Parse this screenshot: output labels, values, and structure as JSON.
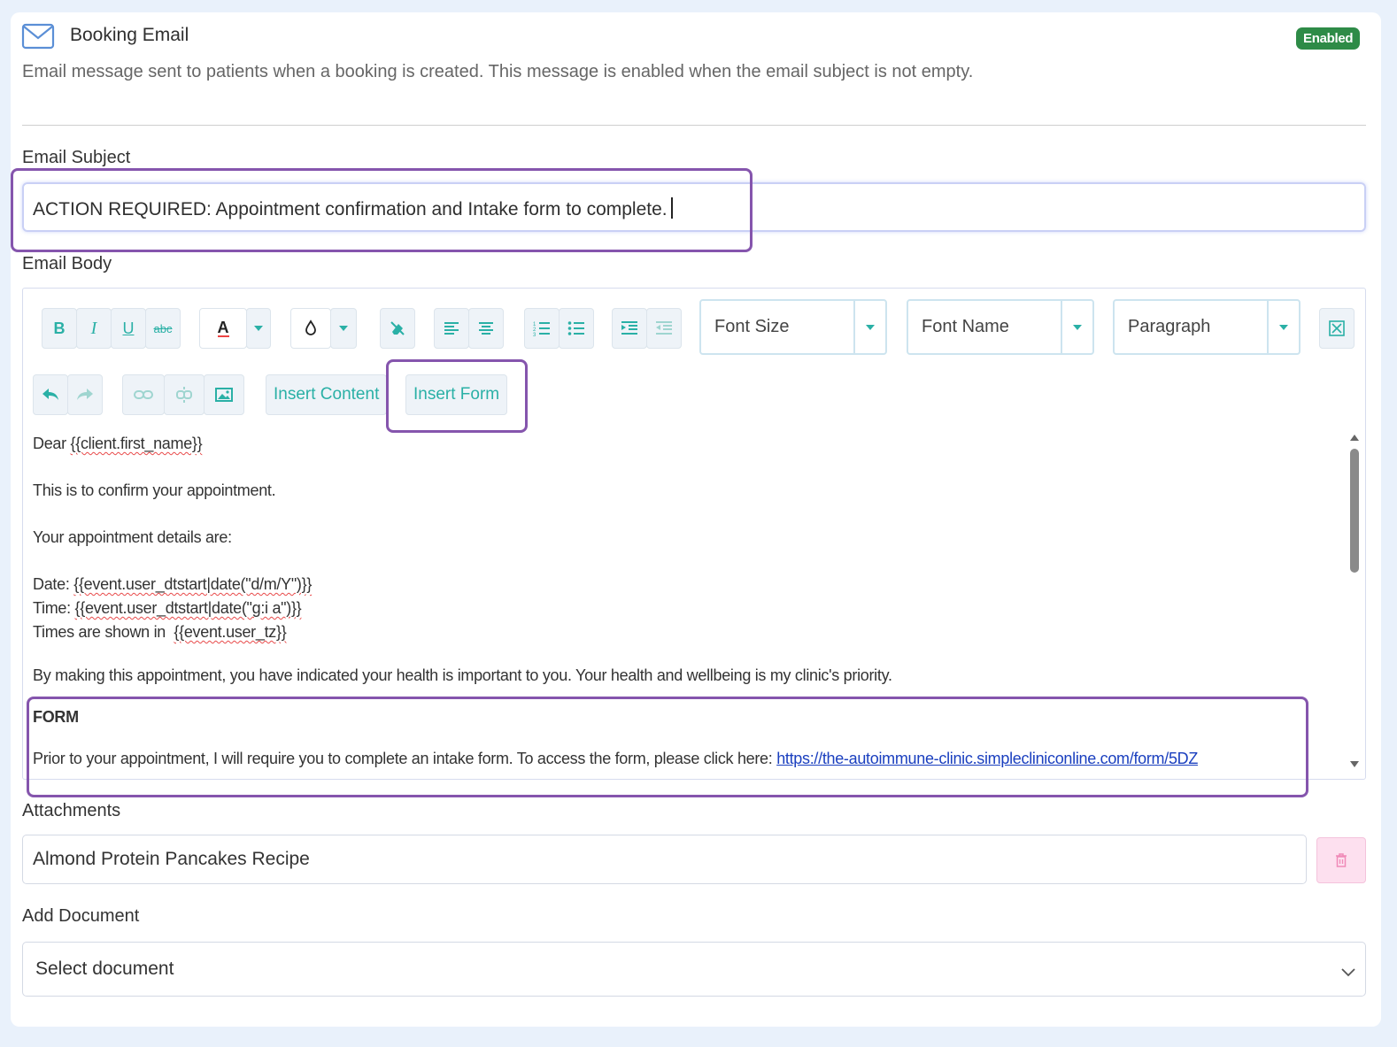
{
  "header": {
    "title": "Booking Email",
    "badge": "Enabled",
    "description": "Email message sent to patients when a booking is created. This message is enabled when the email subject is not empty."
  },
  "subject": {
    "label": "Email Subject",
    "value": "ACTION REQUIRED: Appointment confirmation and Intake form to complete."
  },
  "body": {
    "label": "Email Body",
    "toolbar": {
      "bold": "B",
      "italic": "I",
      "underline": "U",
      "strike": "abc",
      "font_color": "A",
      "font_size": "Font Size",
      "font_name": "Font Name",
      "format": "Paragraph",
      "insert_content": "Insert Content",
      "insert_form": "Insert Form"
    },
    "content": {
      "greeting_prefix": "Dear ",
      "greeting_var": "{{client.first_name}}",
      "line1": "This is to confirm your appointment.",
      "line2": "Your appointment details are:",
      "date_prefix": "Date: ",
      "date_var": "{{event.user_dtstart|date(\"d/m/Y\")}}",
      "time_prefix": "Time: ",
      "time_var": "{{event.user_dtstart|date(\"g:i a\")}}",
      "tz_prefix": "Times are shown in  ",
      "tz_var": "{{event.user_tz}}",
      "line3": "By making this appointment, you have indicated your health is important to you.  Your health and wellbeing is my clinic's priority.",
      "form_heading": "FORM",
      "form_text": "Prior to your appointment, I will require you to complete an intake form. To access the form, please click here: ",
      "form_link": "https://the-autoimmune-clinic.simplecliniconline.com/form/5DZ"
    }
  },
  "attachments": {
    "label": "Attachments",
    "value": "Almond Protein Pancakes Recipe"
  },
  "add_document": {
    "label": "Add Document",
    "placeholder": "Select document"
  },
  "colors": {
    "accent": "#2ab0a6",
    "badge": "#2e8b47",
    "highlight": "#8555ad",
    "link": "#1a3fbf"
  }
}
